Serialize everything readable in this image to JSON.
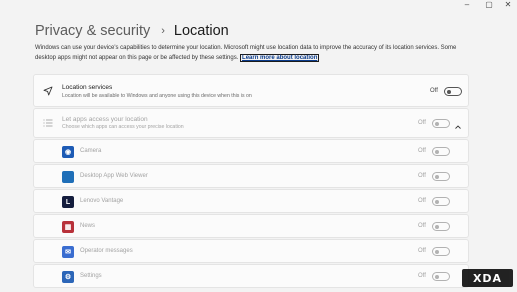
{
  "window": {
    "minimize_glyph": "–",
    "maximize_glyph": "▢",
    "close_glyph": "✕"
  },
  "breadcrumb": {
    "parent": "Privacy & security",
    "separator": "›",
    "current": "Location"
  },
  "description": {
    "text": "Windows can use your device's capabilities to determine your location. Microsoft might use location data to improve the accuracy of its location services. Some desktop apps might not appear on this page or be affected by these settings.",
    "link": "Learn more about location"
  },
  "location_services": {
    "icon": "location-arrow-icon",
    "title": "Location services",
    "subtitle": "Location will be available to Windows and anyone using this device when this is on",
    "state": "Off",
    "on": false
  },
  "apps_access": {
    "icon": "list-icon",
    "title": "Let apps access your location",
    "subtitle": "Choose which apps can access your precise location",
    "state": "Off",
    "on": false,
    "expanded": true
  },
  "apps": [
    {
      "name": "Camera",
      "icon": "camera-app-icon",
      "color": "#1d5bb5",
      "glyph": "◉",
      "state": "Off",
      "on": false
    },
    {
      "name": "Desktop App Web Viewer",
      "icon": "web-viewer-app-icon",
      "color": "#1f6fb8",
      "glyph": "",
      "state": "Off",
      "on": false
    },
    {
      "name": "Lenovo Vantage",
      "icon": "lenovo-vantage-app-icon",
      "color": "#141d3d",
      "glyph": "L",
      "state": "Off",
      "on": false
    },
    {
      "name": "News",
      "icon": "news-app-icon",
      "color": "#b8313a",
      "glyph": "▦",
      "state": "Off",
      "on": false
    },
    {
      "name": "Operator messages",
      "icon": "operator-messages-app-icon",
      "color": "#3a6dd0",
      "glyph": "✉",
      "state": "Off",
      "on": false
    },
    {
      "name": "Settings",
      "icon": "settings-app-icon",
      "color": "#2c66b8",
      "glyph": "⚙",
      "state": "Off",
      "on": false
    }
  ],
  "watermark": {
    "text": "XDA"
  }
}
